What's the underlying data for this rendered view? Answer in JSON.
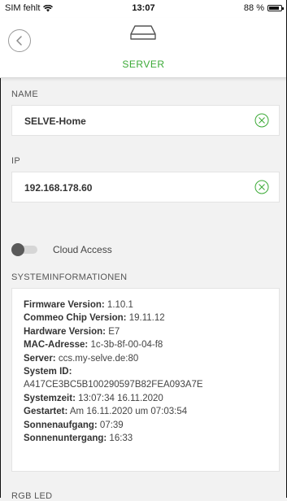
{
  "status_bar": {
    "carrier": "SIM fehlt",
    "time": "13:07",
    "battery": "88 %"
  },
  "nav": {
    "title": "SERVER",
    "back_icon": "chevron-left-icon",
    "server_icon": "server-icon"
  },
  "colors": {
    "accent": "#3aa935",
    "background": "#f2f2f2",
    "card": "#ffffff"
  },
  "fields": {
    "name": {
      "label": "NAME",
      "value": "SELVE-Home"
    },
    "ip": {
      "label": "IP",
      "value": "192.168.178.60"
    }
  },
  "cloud_access": {
    "label": "Cloud Access",
    "enabled": false
  },
  "system_info": {
    "label": "SYSTEMINFORMATIONEN",
    "firmware_key": "Firmware Version:",
    "firmware_val": "1.10.1",
    "commeo_key": "Commeo Chip Version:",
    "commeo_val": "19.11.12",
    "hardware_key": "Hardware Version:",
    "hardware_val": "E7",
    "mac_key": "MAC-Adresse:",
    "mac_val": "1c-3b-8f-00-04-f8",
    "server_key": "Server:",
    "server_val": "ccs.my-selve.de:80",
    "system_id_key": "System ID:",
    "system_id_val": "A417CE3BC5B100290597B82FEA093A7E",
    "systemzeit_key": "Systemzeit:",
    "systemzeit_val": "13:07:34 16.11.2020",
    "gestartet_key": "Gestartet:",
    "gestartet_val": "Am 16.11.2020 um 07:03:54",
    "sunrise_key": "Sonnenaufgang:",
    "sunrise_val": "07:39",
    "sunset_key": "Sonnenuntergang:",
    "sunset_val": "16:33"
  },
  "bottom_section": {
    "label": "RGB LED"
  }
}
